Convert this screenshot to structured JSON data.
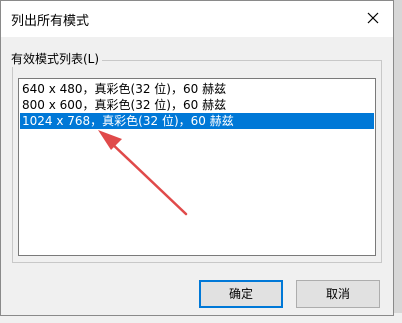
{
  "window": {
    "title": "列出所有模式"
  },
  "group": {
    "label": "有效模式列表(L)"
  },
  "list": {
    "items": [
      {
        "label": "640 x 480，真彩色(32 位)，60 赫兹"
      },
      {
        "label": "800 x 600，真彩色(32 位)，60 赫兹"
      },
      {
        "label": "1024 x 768，真彩色(32 位)，60 赫兹"
      }
    ],
    "selected_index": 2
  },
  "buttons": {
    "ok_label": "确定",
    "cancel_label": "取消"
  },
  "colors": {
    "selection": "#0078d7",
    "arrow": "#e04a4a"
  }
}
